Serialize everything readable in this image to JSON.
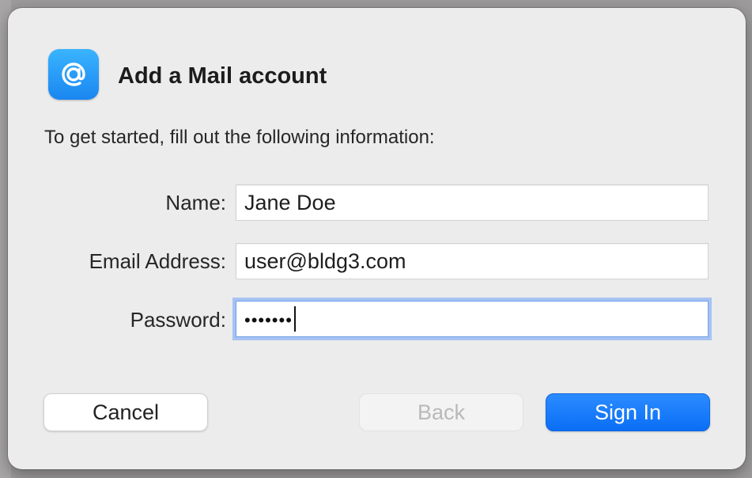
{
  "dialog": {
    "title": "Add a Mail account",
    "instructions": "To get started, fill out the following information:",
    "app_icon": "at-sign-icon",
    "fields": {
      "name": {
        "label": "Name:",
        "value": "Jane Doe"
      },
      "email": {
        "label": "Email Address:",
        "value": "user@bldg3.com"
      },
      "password": {
        "label": "Password:",
        "masked_value": "•••••••"
      }
    },
    "buttons": {
      "cancel": "Cancel",
      "back": "Back",
      "sign_in": "Sign In"
    }
  },
  "colors": {
    "accent": "#0a6ef5",
    "focus_ring": "#a6c3f2",
    "dialog_bg": "#ececec"
  }
}
